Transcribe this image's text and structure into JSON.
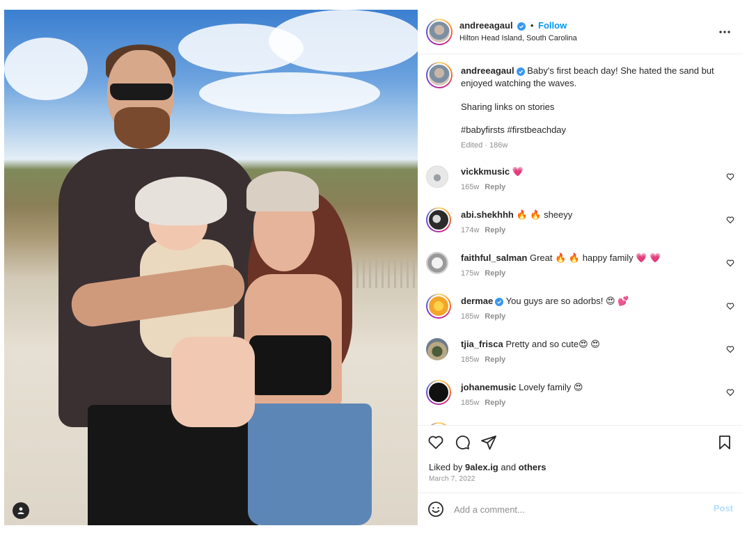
{
  "post": {
    "author": "andreeagaul",
    "follow_label": "Follow",
    "separator": "•",
    "location": "Hilton Head Island, South Carolina",
    "more_icon": "more-horizontal-icon",
    "caption": {
      "line1": "Baby's first beach day! She hated the sand but enjoyed watching the waves.",
      "line2": "Sharing links on stories",
      "hashtags": "#babyfirsts #firstbeachday",
      "edited": "Edited · 186w"
    }
  },
  "comments": [
    {
      "user": "vickkmusic",
      "text": "💗",
      "verified": false,
      "age": "165w",
      "reply": "Reply"
    },
    {
      "user": "abi.shekhhh",
      "text": "🔥 🔥 sheeyy",
      "verified": false,
      "age": "174w",
      "reply": "Reply"
    },
    {
      "user": "faithful_salman",
      "text": "Great 🔥 🔥 happy family 💗 💗",
      "verified": false,
      "age": "175w",
      "reply": "Reply"
    },
    {
      "user": "dermae",
      "text": "You guys are so adorbs! 😍 💕",
      "verified": true,
      "age": "185w",
      "reply": "Reply"
    },
    {
      "user": "tjia_frisca",
      "text": "Pretty and so cute😍 😍",
      "verified": false,
      "age": "185w",
      "reply": "Reply"
    },
    {
      "user": "johanemusic",
      "text": "Lovely family 😍",
      "verified": false,
      "age": "185w",
      "reply": "Reply"
    }
  ],
  "actions": {
    "like_icon": "heart-icon",
    "comment_icon": "comment-icon",
    "share_icon": "share-icon",
    "save_icon": "bookmark-icon"
  },
  "likes": {
    "prefix": "Liked by",
    "user": "9alex.ig",
    "and": "and",
    "others": "others"
  },
  "date": "March 7, 2022",
  "composer": {
    "placeholder": "Add a comment...",
    "post_label": "Post",
    "emoji_icon": "smiley-icon"
  },
  "colors": {
    "verified": "#3897f0",
    "link_blue": "#0095f6",
    "hashtag": "#00376b",
    "muted": "#8e8e8e"
  }
}
